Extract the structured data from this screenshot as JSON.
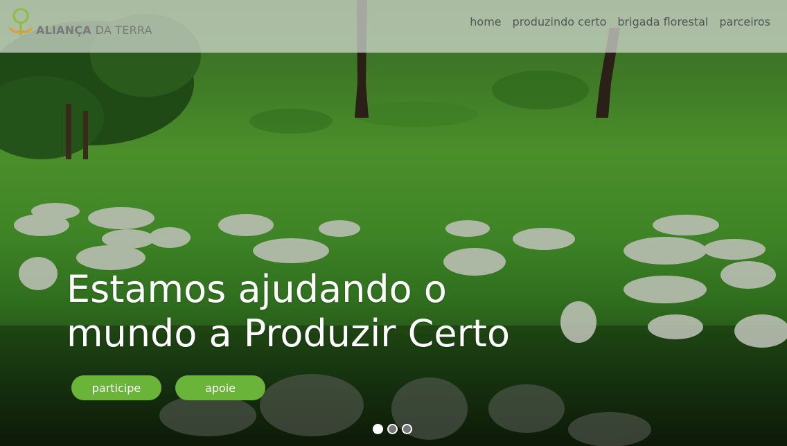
{
  "brand": {
    "name_part1": "ALIANÇA",
    "name_part2": "DA TERRA",
    "colors": {
      "logo_green": "#8cbf3f",
      "logo_orange": "#e59b2f"
    }
  },
  "nav": {
    "items": [
      {
        "label": "home"
      },
      {
        "label": "produzindo certo"
      },
      {
        "label": "brigada florestal"
      },
      {
        "label": "parceiros"
      }
    ]
  },
  "hero": {
    "headline_line1": "Estamos ajudando o",
    "headline_line2": "mundo a Produzir Certo",
    "buttons": [
      {
        "label": "participe"
      },
      {
        "label": "apoie"
      }
    ],
    "button_color": "#6ab43a",
    "slides": {
      "count": 3,
      "active_index": 0
    }
  }
}
